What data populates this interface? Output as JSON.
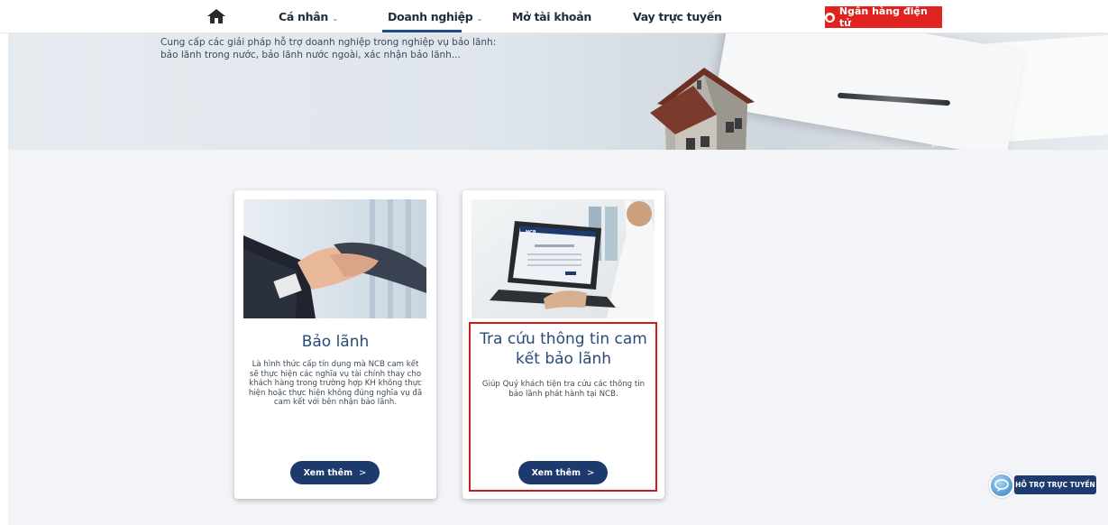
{
  "nav": {
    "items": [
      {
        "label": "Cá nhân",
        "has_caret": true
      },
      {
        "label": "Doanh nghiệp",
        "has_caret": true
      },
      {
        "label": "Mở tài khoản",
        "has_caret": false
      },
      {
        "label": "Vay trực tuyến",
        "has_caret": false
      }
    ],
    "caret": "⌄",
    "ebank_label": "Ngân hàng điện tử",
    "active_item": "Doanh nghiệp",
    "colors": {
      "accent": "#1e4b8c",
      "ebank": "#e0231f"
    }
  },
  "banner": {
    "description": "Cung cấp các giải pháp hỗ trợ doanh nghiệp trong nghiệp vụ bảo lãnh: bảo lãnh trong nước, bảo lãnh nước ngoài, xác nhận bảo lãnh..."
  },
  "cards": [
    {
      "title": "Bảo lãnh",
      "body": "Là hình thức cấp tín dụng mà NCB cam kết sẽ thực hiện các nghĩa vụ tài chính thay cho khách hàng trong trường hợp KH không thực hiện hoặc thực hiện không đúng nghĩa vụ đã cam kết với bên nhận bảo lãnh.",
      "button": "Xem thêm",
      "image": "handshake-photo"
    },
    {
      "title": "Tra cứu thông tin cam kết bảo lãnh",
      "body": "Giúp Quý khách tiện tra cứu các thông tin bảo lãnh phát hành tại NCB.",
      "button": "Xem thêm",
      "image": "laptop-photo"
    }
  ],
  "support": {
    "label": "HỖ TRỢ TRỰC TUYẾN"
  },
  "laptop_screen": {
    "logo": "NCB"
  }
}
